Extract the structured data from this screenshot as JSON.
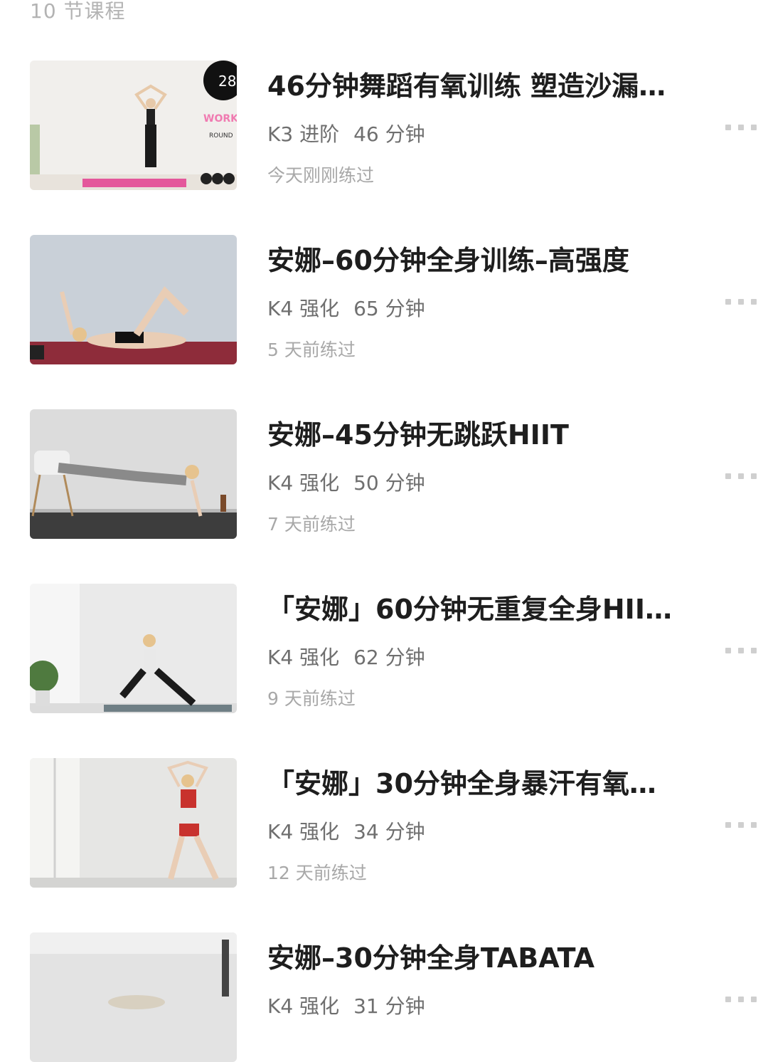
{
  "header": {
    "lesson_count": "10 节课程"
  },
  "courses": [
    {
      "title": "46分钟舞蹈有氧训练 塑造沙漏…",
      "level": "K3 进阶",
      "duration": "46 分钟",
      "last_trained": "今天刚刚练过",
      "thumb": {
        "bg": "#f1efec",
        "mat": "#e4579b",
        "overlay_number": "28",
        "overlay_work": "WORK",
        "overlay_round": "ROUND"
      }
    },
    {
      "title": "安娜–60分钟全身训练–高强度",
      "level": "K4 强化",
      "duration": "65 分钟",
      "last_trained": "5 天前练过",
      "thumb": {
        "bg": "#c9d0d8",
        "mat": "#8e2c3a"
      }
    },
    {
      "title": "安娜–45分钟无跳跃HIIT",
      "level": "K4 强化",
      "duration": "50 分钟",
      "last_trained": "7 天前练过",
      "thumb": {
        "bg": "#dcdcdc",
        "mat": "#3d3d3d"
      }
    },
    {
      "title": "「安娜」60分钟无重复全身HII…",
      "level": "K4 强化",
      "duration": "62 分钟",
      "last_trained": "9 天前练过",
      "thumb": {
        "bg": "#eaeaea",
        "mat": "#6f7f85"
      }
    },
    {
      "title": "「安娜」30分钟全身暴汗有氧…",
      "level": "K4 强化",
      "duration": "34 分钟",
      "last_trained": "12 天前练过",
      "thumb": {
        "bg": "#e6e6e4",
        "mat": "#d8d8d8"
      }
    },
    {
      "title": "安娜–30分钟全身TABATA",
      "level": "K4 强化",
      "duration": "31 分钟",
      "last_trained": "",
      "thumb": {
        "bg": "#e3e3e3",
        "mat": "#cfcfcf"
      }
    }
  ]
}
